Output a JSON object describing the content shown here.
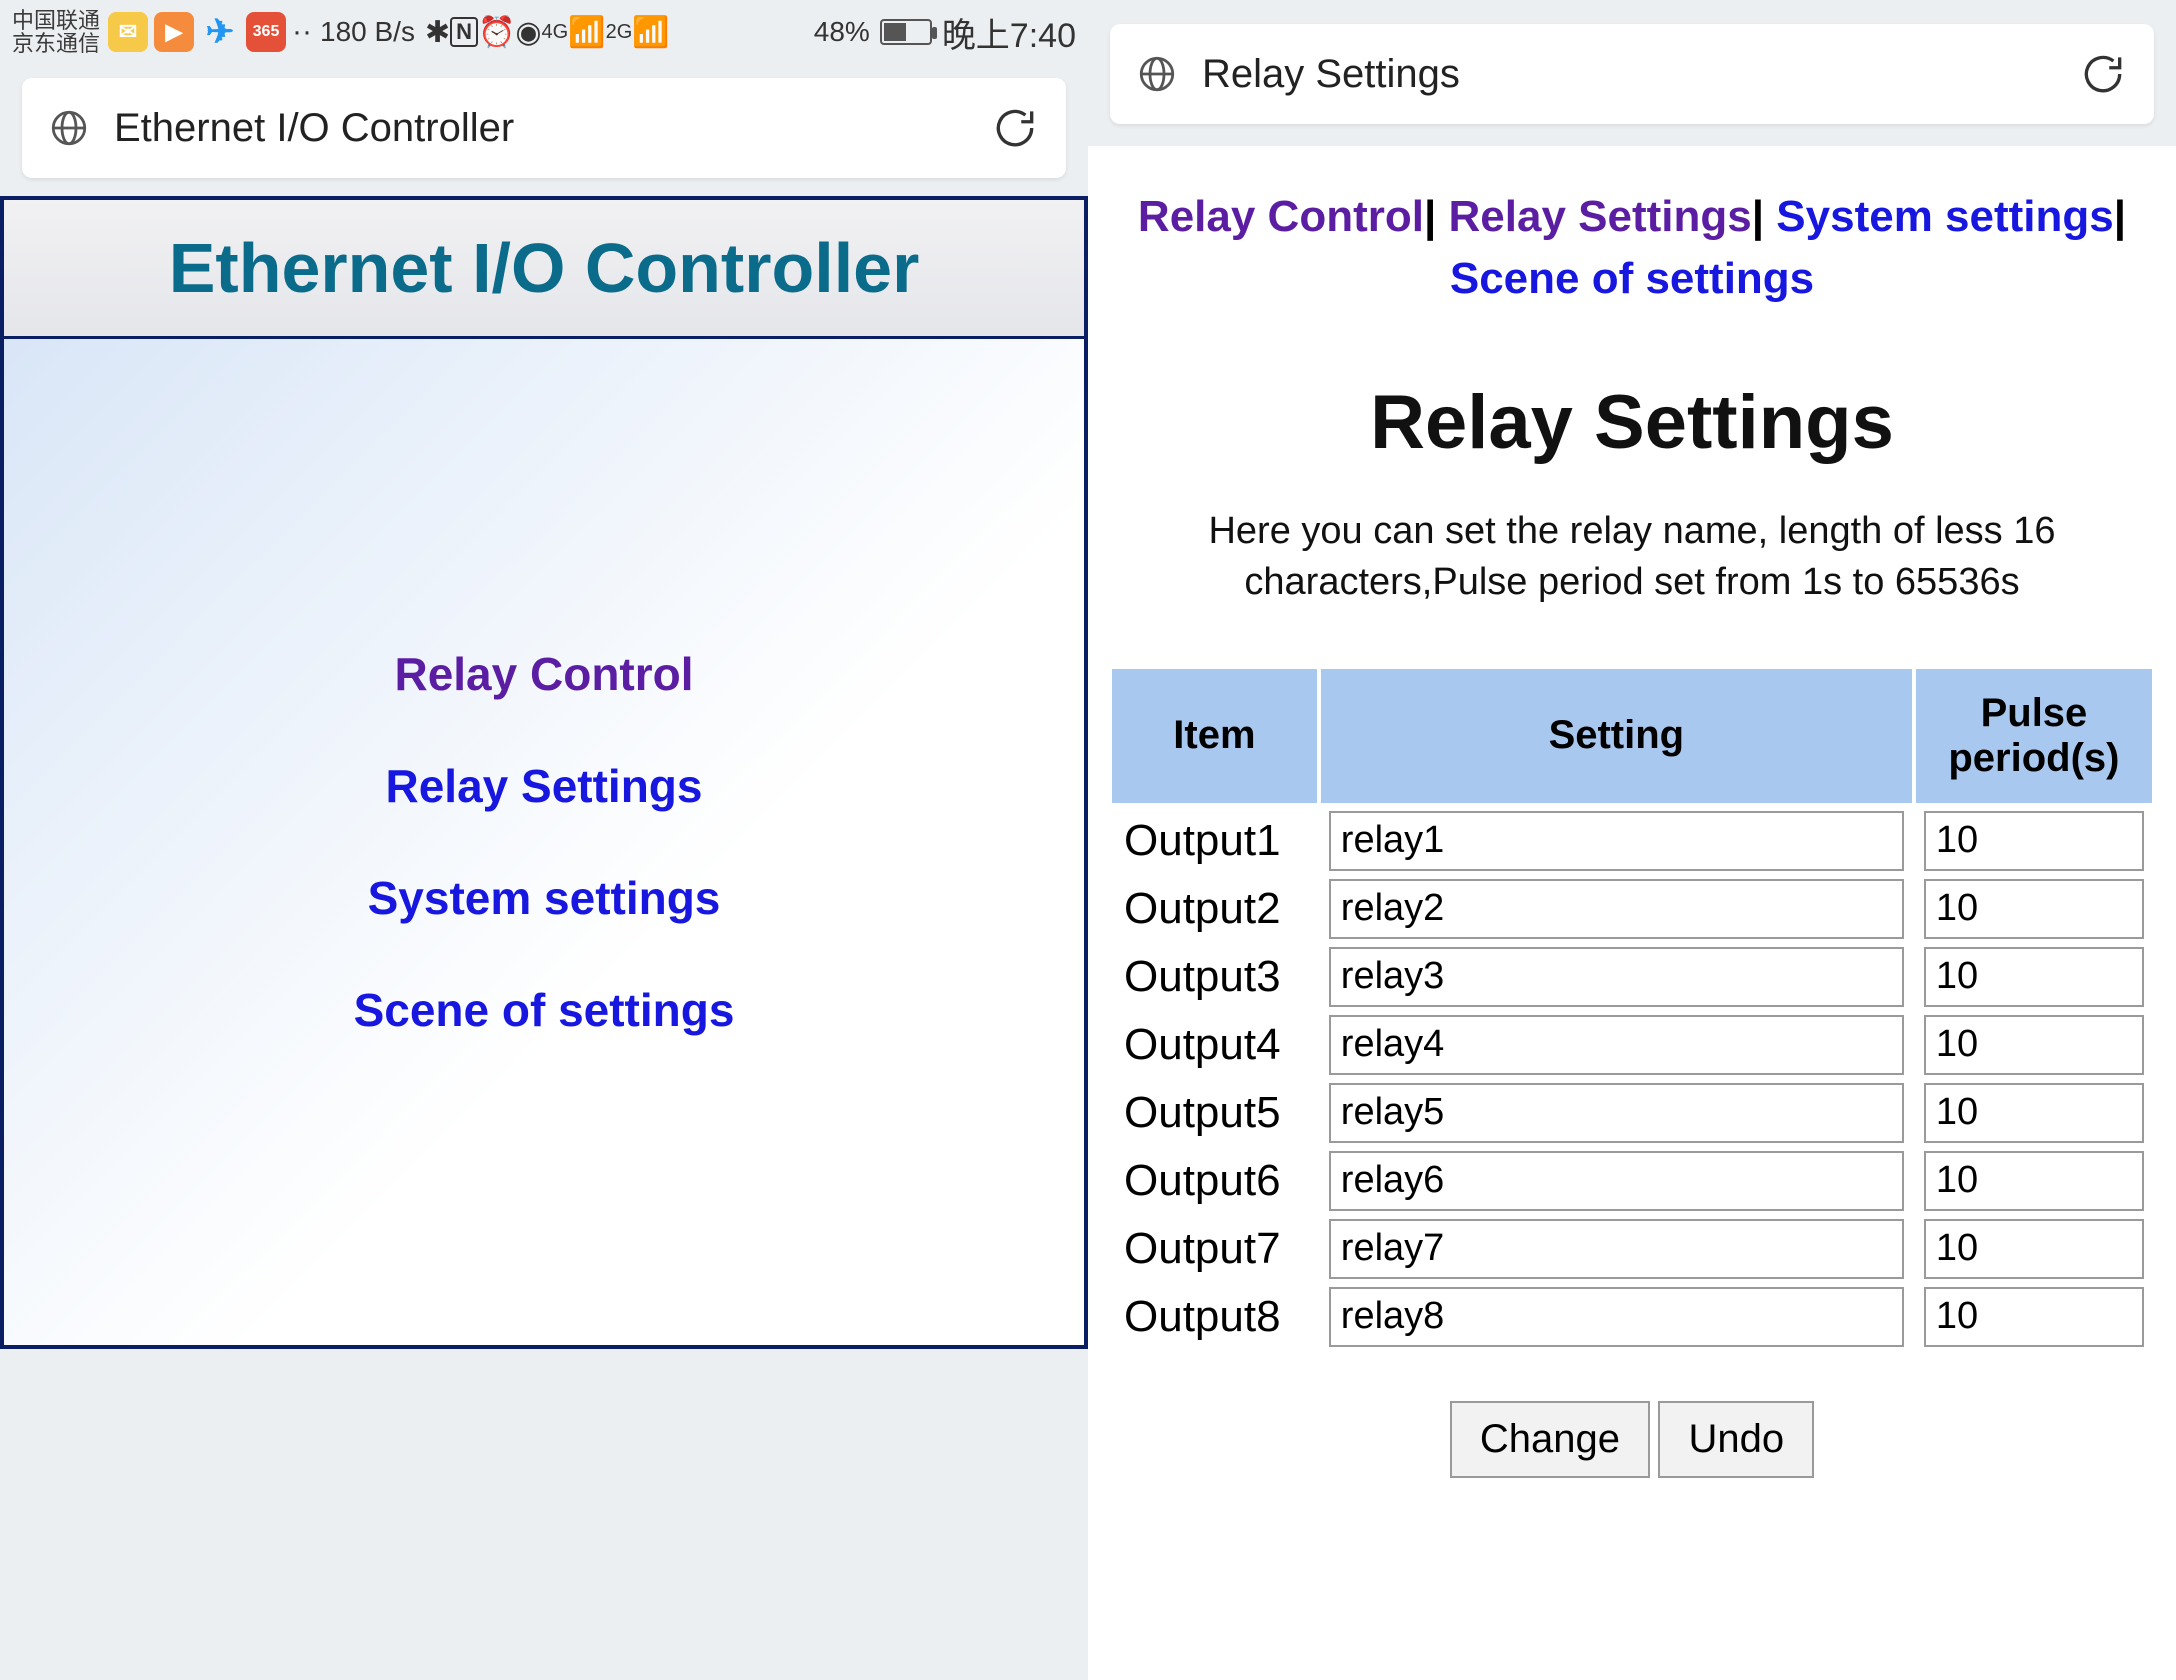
{
  "statusbar": {
    "carrier1": "中国联通",
    "carrier2": "京东通信",
    "net_rate": "180 B/s",
    "net_4g": "4G",
    "net_2g": "2G",
    "battery_pct": "48%",
    "clock": "晚上7:40"
  },
  "left": {
    "address_title": "Ethernet I/O Controller",
    "page_title": "Ethernet I/O Controller",
    "nav": {
      "relay_control": "Relay Control",
      "relay_settings": "Relay Settings",
      "system_settings": "System settings",
      "scene_settings": "Scene of settings"
    }
  },
  "right": {
    "address_title": "Relay Settings",
    "nav": {
      "relay_control": "Relay Control",
      "relay_settings": "Relay Settings",
      "system_settings": "System settings",
      "scene_settings": "Scene of settings"
    },
    "heading": "Relay Settings",
    "description": "Here you can set the relay name, length of less 16 characters,Pulse period set from 1s to 65536s",
    "table": {
      "headers": {
        "item": "Item",
        "setting": "Setting",
        "pulse": "Pulse period(s)"
      },
      "rows": [
        {
          "item": "Output1",
          "setting": "relay1",
          "pulse": "10"
        },
        {
          "item": "Output2",
          "setting": "relay2",
          "pulse": "10"
        },
        {
          "item": "Output3",
          "setting": "relay3",
          "pulse": "10"
        },
        {
          "item": "Output4",
          "setting": "relay4",
          "pulse": "10"
        },
        {
          "item": "Output5",
          "setting": "relay5",
          "pulse": "10"
        },
        {
          "item": "Output6",
          "setting": "relay6",
          "pulse": "10"
        },
        {
          "item": "Output7",
          "setting": "relay7",
          "pulse": "10"
        },
        {
          "item": "Output8",
          "setting": "relay8",
          "pulse": "10"
        }
      ]
    },
    "buttons": {
      "change": "Change",
      "undo": "Undo"
    }
  }
}
